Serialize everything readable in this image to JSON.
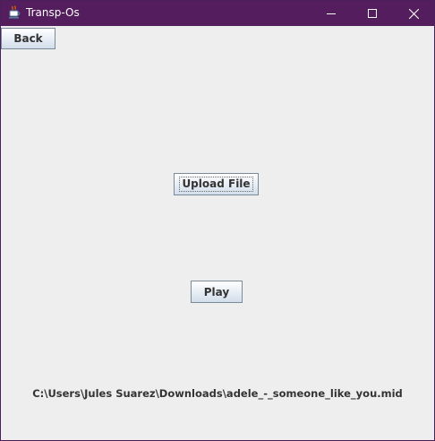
{
  "window": {
    "title": "Transp-Os",
    "icon": "java-coffee-cup-icon",
    "title_bar_color": "#541d5d",
    "controls": {
      "minimize_icon": "minimize-icon",
      "maximize_icon": "maximize-icon",
      "close_icon": "close-icon"
    }
  },
  "main": {
    "back_label": "Back",
    "upload_label": "Upload File",
    "play_label": "Play",
    "file_path": "C:\\Users\\Jules Suarez\\Downloads\\adele_-_someone_like_you.mid"
  }
}
